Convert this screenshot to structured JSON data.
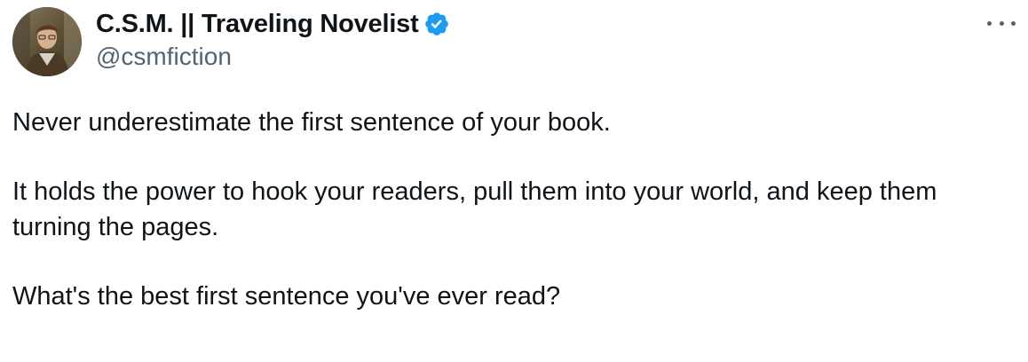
{
  "author": {
    "display_name": "C.S.M. || Traveling Novelist",
    "handle": "@csmfiction",
    "verified": true,
    "avatar_icon": "profile-photo",
    "verified_icon": "verified-badge-icon",
    "verified_color": "#1d9bf0"
  },
  "menu": {
    "icon": "more-options-icon"
  },
  "tweet": {
    "paragraphs": [
      "Never underestimate the first sentence of your book.",
      "It holds the power to hook your readers, pull them into your world, and keep them turning the pages.",
      "What's the best first sentence you've ever read?"
    ]
  },
  "colors": {
    "text_primary": "#0f1419",
    "text_secondary": "#536471",
    "accent": "#1d9bf0",
    "background": "#ffffff"
  }
}
